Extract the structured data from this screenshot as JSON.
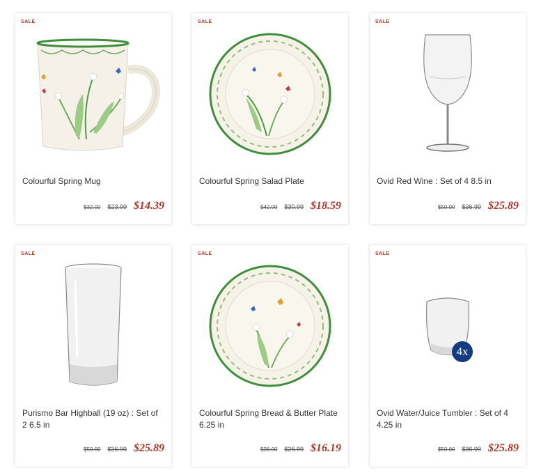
{
  "products": [
    {
      "sale": "SALE",
      "name": "Colourful Spring Mug",
      "original_price": "$32.00",
      "was_price": "$23.99",
      "sale_price": "$14.39",
      "image": "mug-image"
    },
    {
      "sale": "SALE",
      "name": "Colourful Spring Salad Plate",
      "original_price": "$42.00",
      "was_price": "$30.99",
      "sale_price": "$18.59",
      "image": "plate-image"
    },
    {
      "sale": "SALE",
      "name": "Ovid Red Wine : Set of 4 8.5 in",
      "original_price": "$50.00",
      "was_price": "$36.99",
      "sale_price": "$25.89",
      "image": "wine-glass-image"
    },
    {
      "sale": "SALE",
      "name": "Purismo Bar Highball (19 oz) : Set of 2 6.5 in",
      "original_price": "$50.00",
      "was_price": "$36.99",
      "sale_price": "$25.89",
      "image": "highball-glass-image"
    },
    {
      "sale": "SALE",
      "name": "Colourful Spring Bread & Butter Plate 6.25 in",
      "original_price": "$36.00",
      "was_price": "$26.99",
      "sale_price": "$16.19",
      "image": "plate-image"
    },
    {
      "sale": "SALE",
      "name": "Ovid Water/Juice Tumbler : Set of 4 4.25 in",
      "original_price": "$50.00",
      "was_price": "$36.99",
      "sale_price": "$25.89",
      "image": "tumbler-image",
      "badge": "4x"
    }
  ],
  "colors": {
    "sale": "#b0362a",
    "badge": "#123b82",
    "rim_green": "#3e8f3a"
  }
}
